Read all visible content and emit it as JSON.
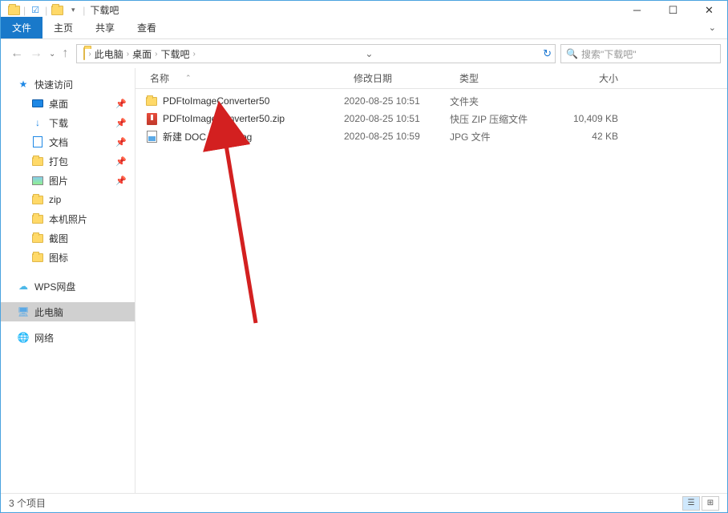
{
  "window": {
    "title": "下载吧",
    "qat_icons": [
      "folder-icon",
      "check-icon",
      "folder-icon"
    ]
  },
  "ribbon": {
    "file": "文件",
    "tabs": [
      "主页",
      "共享",
      "查看"
    ]
  },
  "breadcrumb": {
    "items": [
      "此电脑",
      "桌面",
      "下载吧"
    ]
  },
  "search": {
    "placeholder": "搜索\"下载吧\""
  },
  "sidebar": {
    "quick_access": "快速访问",
    "items": [
      {
        "label": "桌面",
        "icon": "desktop-icon",
        "pinned": true
      },
      {
        "label": "下载",
        "icon": "download-icon",
        "pinned": true
      },
      {
        "label": "文档",
        "icon": "document-icon",
        "pinned": true
      },
      {
        "label": "打包",
        "icon": "folder-icon",
        "pinned": true
      },
      {
        "label": "图片",
        "icon": "image-icon",
        "pinned": true
      },
      {
        "label": "zip",
        "icon": "folder-icon",
        "pinned": false
      },
      {
        "label": "本机照片",
        "icon": "folder-icon",
        "pinned": false
      },
      {
        "label": "截图",
        "icon": "folder-icon",
        "pinned": false
      },
      {
        "label": "图标",
        "icon": "folder-icon",
        "pinned": false
      }
    ],
    "wps": "WPS网盘",
    "this_pc": "此电脑",
    "network": "网络"
  },
  "columns": {
    "name": "名称",
    "date": "修改日期",
    "type": "类型",
    "size": "大小"
  },
  "files": [
    {
      "name": "PDFtoImageConverter50",
      "date": "2020-08-25 10:51",
      "type": "文件夹",
      "size": "",
      "icon": "folder"
    },
    {
      "name": "PDFtoImageConverter50.zip",
      "date": "2020-08-25 10:51",
      "type": "快压 ZIP 压缩文件",
      "size": "10,409 KB",
      "icon": "zip"
    },
    {
      "name": "新建 DOC 文档-1.jpg",
      "date": "2020-08-25 10:59",
      "type": "JPG 文件",
      "size": "42 KB",
      "icon": "jpg"
    }
  ],
  "statusbar": {
    "item_count": "3 个项目"
  }
}
